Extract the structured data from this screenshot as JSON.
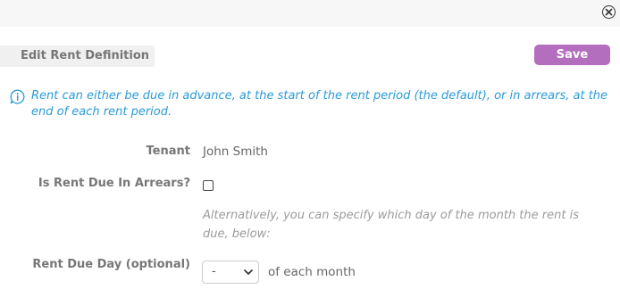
{
  "dialog": {
    "title": "Edit Rent Definition",
    "save_label": "Save",
    "close_icon": "close-circle-icon"
  },
  "info": {
    "icon": "info-icon",
    "text": "Rent can either be due in advance, at the start of the rent period (the default), or in arrears, at the end of each rent period."
  },
  "form": {
    "tenant_label": "Tenant",
    "tenant_value": "John Smith",
    "arrears_label": "Is Rent Due In Arrears?",
    "arrears_checked": false,
    "hint": "Alternatively, you can specify which day of the month the rent is due, below:",
    "due_day_label": "Rent Due Day (optional)",
    "due_day_value": "-",
    "due_day_suffix": "of each month"
  },
  "colors": {
    "accent": "#b46ebe",
    "info": "#2a9bd6"
  }
}
